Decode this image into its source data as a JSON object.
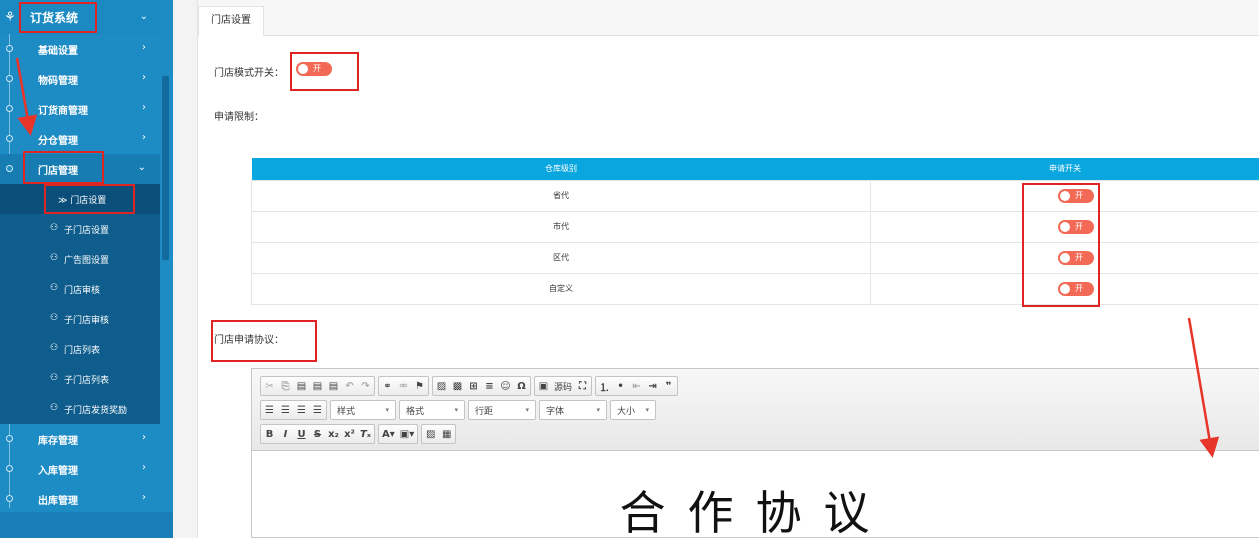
{
  "sidebar": {
    "system_title": "订货系统",
    "items": [
      {
        "label": "基础设置"
      },
      {
        "label": "物码管理"
      },
      {
        "label": "订货商管理"
      },
      {
        "label": "分仓管理"
      },
      {
        "label": "门店管理"
      }
    ],
    "store_submenu": [
      {
        "label": "≫ 门店设置"
      },
      {
        "label": "子门店设置"
      },
      {
        "label": "广告图设置"
      },
      {
        "label": "门店审核"
      },
      {
        "label": "子门店审核"
      },
      {
        "label": "门店列表"
      },
      {
        "label": "子门店列表"
      },
      {
        "label": "子门店发货奖励"
      }
    ],
    "items_after": [
      {
        "label": "库存管理"
      },
      {
        "label": "入库管理"
      },
      {
        "label": "出库管理"
      }
    ]
  },
  "tabs": [
    {
      "label": "门店设置"
    }
  ],
  "form": {
    "store_mode_label": "门店模式开关：",
    "store_mode_toggle": "开",
    "apply_limit_label": "申请限制：",
    "agreement_label": "门店申请协议："
  },
  "table": {
    "headers": [
      "仓库级别",
      "申请开关"
    ],
    "rows": [
      {
        "level": "省代",
        "toggle": "开"
      },
      {
        "level": "市代",
        "toggle": "开"
      },
      {
        "level": "区代",
        "toggle": "开"
      },
      {
        "level": "自定义",
        "toggle": "开"
      }
    ]
  },
  "editor": {
    "source_label": "源码",
    "combo_style": "样式",
    "combo_format": "格式",
    "combo_line": "行距",
    "combo_font": "字体",
    "combo_size": "大小",
    "doc_title": "合作协议"
  },
  "colors": {
    "sidebar_bg": "#1d8bc4",
    "submenu_bg": "#0f5d8d",
    "table_header": "#0aa6df",
    "toggle_on": "#f26a55",
    "highlight": "#e02424"
  }
}
